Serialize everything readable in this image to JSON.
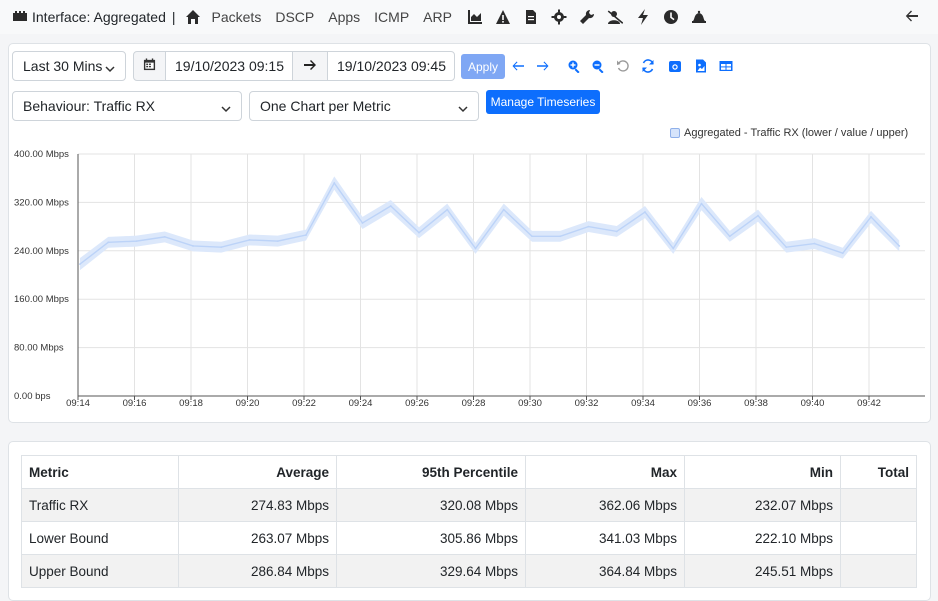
{
  "header": {
    "title": "Interface: Aggregated",
    "separator": "|",
    "nav": [
      "Packets",
      "DSCP",
      "Apps",
      "ICMP",
      "ARP"
    ],
    "icons": [
      "chart-area-icon",
      "warning-icon",
      "file-icon",
      "gear-icon",
      "wrench-icon",
      "user-slash-icon",
      "bolt-icon",
      "clock-icon",
      "bell-icon"
    ]
  },
  "toolbar": {
    "range": "Last 30 Mins",
    "start": "19/10/2023 09:15",
    "end": "19/10/2023 09:45",
    "apply": "Apply",
    "behaviour": "Behaviour: Traffic RX",
    "layout": "One Chart per Metric",
    "manage": "Manage Timeseries",
    "colors": {
      "primary": "#0d6efd",
      "primary_light": "#7fa7f4"
    }
  },
  "legend": {
    "label": "Aggregated - Traffic RX (lower / value / upper)"
  },
  "chart_data": {
    "type": "area",
    "y_ticks": [
      "0.00 bps",
      "80.00 Mbps",
      "160.00 Mbps",
      "240.00 Mbps",
      "320.00 Mbps",
      "400.00 Mbps"
    ],
    "ylim": [
      0,
      400
    ],
    "x_ticks": [
      "09:14",
      "09:16",
      "09:18",
      "09:20",
      "09:22",
      "09:24",
      "09:26",
      "09:28",
      "09:30",
      "09:32",
      "09:34",
      "09:36",
      "09:38",
      "09:40",
      "09:42"
    ],
    "x": [
      "09:14",
      "09:15",
      "09:16",
      "09:17",
      "09:18",
      "09:19",
      "09:20",
      "09:21",
      "09:22",
      "09:23",
      "09:24",
      "09:25",
      "09:26",
      "09:27",
      "09:28",
      "09:29",
      "09:30",
      "09:31",
      "09:32",
      "09:33",
      "09:34",
      "09:35",
      "09:36",
      "09:37",
      "09:38",
      "09:39",
      "09:40",
      "09:41",
      "09:42",
      "09:43"
    ],
    "series": [
      {
        "name": "Aggregated - Traffic RX",
        "values": [
          218,
          254,
          256,
          263,
          248,
          246,
          258,
          256,
          266,
          352,
          286,
          314,
          270,
          308,
          244,
          308,
          264,
          264,
          280,
          272,
          304,
          244,
          318,
          264,
          298,
          246,
          252,
          236,
          296,
          248
        ]
      },
      {
        "lower": [
          208,
          245,
          247,
          254,
          239,
          237,
          249,
          247,
          257,
          341,
          276,
          304,
          261,
          298,
          235,
          298,
          255,
          255,
          271,
          263,
          294,
          235,
          307,
          255,
          288,
          237,
          243,
          227,
          286,
          239
        ]
      },
      {
        "upper": [
          228,
          263,
          265,
          272,
          257,
          255,
          267,
          265,
          275,
          363,
          296,
          324,
          279,
          318,
          253,
          318,
          273,
          273,
          289,
          281,
          314,
          253,
          329,
          273,
          308,
          255,
          261,
          245,
          306,
          257
        ]
      }
    ],
    "grid": true,
    "legend_position": "top-right",
    "colors": {
      "line": "#bcd3f8",
      "band": "#dce8fb"
    }
  },
  "table": {
    "headers": [
      "Metric",
      "Average",
      "95th Percentile",
      "Max",
      "Min",
      "Total"
    ],
    "rows": [
      [
        "Traffic RX",
        "274.83 Mbps",
        "320.08 Mbps",
        "362.06 Mbps",
        "232.07 Mbps",
        ""
      ],
      [
        "Lower Bound",
        "263.07 Mbps",
        "305.86 Mbps",
        "341.03 Mbps",
        "222.10 Mbps",
        ""
      ],
      [
        "Upper Bound",
        "286.84 Mbps",
        "329.64 Mbps",
        "364.84 Mbps",
        "245.51 Mbps",
        ""
      ]
    ]
  }
}
